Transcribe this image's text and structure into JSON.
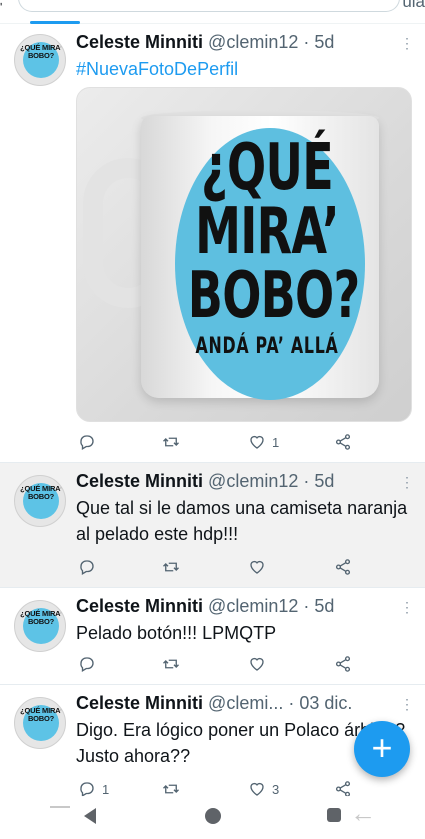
{
  "tabbar": {
    "left_label": "ʹ",
    "right_label": "ula"
  },
  "tweets": [
    {
      "name": "Celeste Minniti",
      "handle": "@clemin12 · 5d",
      "text_hashtag": "#NuevaFotoDePerfil",
      "media": {
        "line1": "¿QUÉ",
        "line2": "MIRA’",
        "line3": "BOBO?",
        "line4": "ANDÁ PA’ ALLÁ"
      },
      "actions": {
        "reply": "",
        "retweet": "",
        "like": "1",
        "share": ""
      }
    },
    {
      "name": "Celeste Minniti",
      "handle": "@clemin12 · 5d",
      "text": "Que tal si le damos una camiseta naranja al pelado este hdp!!!",
      "actions": {
        "reply": "",
        "retweet": "",
        "like": "",
        "share": ""
      }
    },
    {
      "name": "Celeste Minniti",
      "handle": "@clemin12 · 5d",
      "text": "Pelado botón!!! LPMQTP",
      "actions": {
        "reply": "",
        "retweet": "",
        "like": "",
        "share": ""
      }
    },
    {
      "name": "Celeste Minniti",
      "handle": "@clemi... · 03 dic.",
      "text": "Digo. Era lógico poner un Polaco árbitro? Justo ahora??",
      "actions": {
        "reply": "1",
        "retweet": "",
        "like": "3",
        "share": ""
      }
    }
  ],
  "avatar_text": "¿QUÉ MIRA’ BOBO?",
  "fab": {
    "label": "+"
  },
  "colors": {
    "accent": "#1d9bf0",
    "text": "#0f1419",
    "muted": "#536471",
    "mug_blue": "#5ebfe0"
  }
}
